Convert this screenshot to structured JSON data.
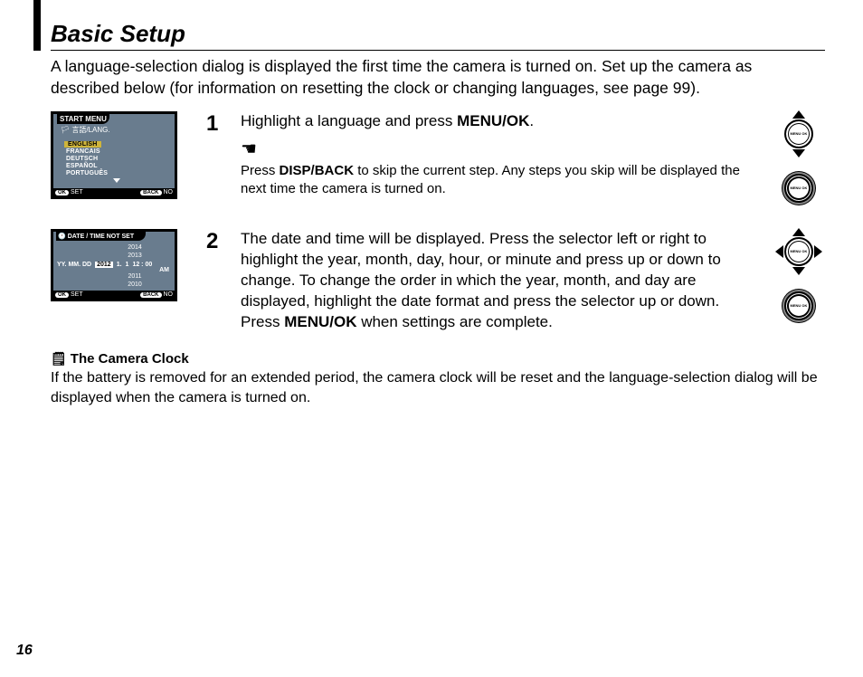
{
  "title": "Basic Setup",
  "intro": "A language-selection dialog is displayed the first time the camera is turned on.  Set up the camera as described below (for information on resetting the clock or changing languages, see page 99).",
  "steps": [
    {
      "num": "1",
      "text_pre": "Highlight a language and press ",
      "text_bold1": "MENU/OK",
      "text_post1": ".",
      "note_pre": "Press ",
      "note_bold": "DISP/BACK",
      "note_post": " to skip the current step.  Any steps you skip will be displayed the next time the camera is turned on."
    },
    {
      "num": "2",
      "text_a": "The date and time will be displayed.  Press the selector left or right to highlight the year, month, day, hour, or minute and press up or down to change.  To change the order in which the year, month, and day are displayed, highlight the date format and press the selector up or down.  Press ",
      "text_b": "MENU/OK",
      "text_c": " when settings are complete."
    }
  ],
  "lcd1": {
    "title": "START MENU",
    "subhead": "言語/LANG.",
    "options": [
      "ENGLISH",
      "FRANCAIS",
      "DEUTSCH",
      "ESPAÑOL",
      "PORTUGUÊS"
    ],
    "footer_set": "SET",
    "footer_back": "BACK",
    "footer_no": "NO",
    "footer_ok": "OK"
  },
  "lcd2": {
    "title": "DATE / TIME NOT SET",
    "years_above": [
      "2014",
      "2013"
    ],
    "format": "YY.  MM.  DD",
    "year_sel": "2012",
    "month": "1.",
    "day": "1",
    "time": "12 : 00",
    "ampm": "AM",
    "years_below": [
      "2011",
      "2010"
    ],
    "footer_set": "SET",
    "footer_back": "BACK",
    "footer_no": "NO",
    "footer_ok": "OK"
  },
  "dial_label": "MENU\nOK",
  "clock_note": {
    "heading": "The Camera Clock",
    "body": "If the battery is removed for an extended period, the camera clock will be reset and the language-selection dialog will be displayed when the camera is turned on."
  },
  "page_num": "16"
}
